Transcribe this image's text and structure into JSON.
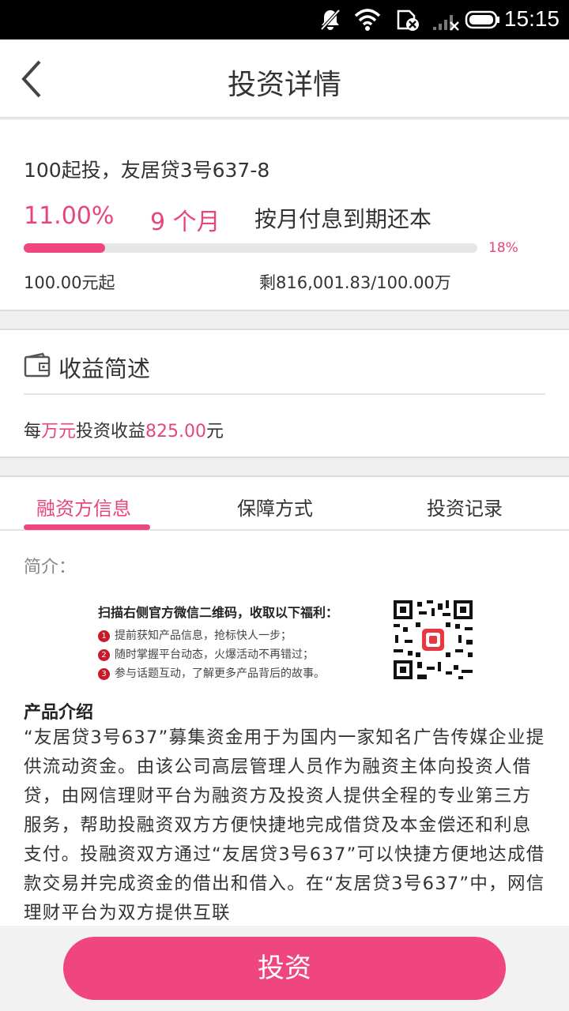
{
  "status_bar": {
    "time": "15:15",
    "icons": [
      "notifications-muted-icon",
      "wifi-icon",
      "sim-disabled-icon",
      "signal-icon",
      "battery-icon"
    ]
  },
  "nav": {
    "title": "投资详情",
    "back_icon": "chevron-left-icon"
  },
  "summary": {
    "name": "100起投，友居贷3号637-8",
    "rate": "11.00%",
    "term": "9 个月",
    "repayment": "按月付息到期还本",
    "progress_fraction": 0.18,
    "progress_label": "18%",
    "min_invest": "100.00元起",
    "remaining": "剩816,001.83/100.00万"
  },
  "earnings": {
    "heading": "收益简述",
    "icon": "wallet-icon",
    "prefix": "每",
    "unit_highlight": "万元",
    "middle": "投资收益",
    "amount": "825.00",
    "suffix": "元"
  },
  "tabs": [
    {
      "label": "融资方信息",
      "active": true
    },
    {
      "label": "保障方式",
      "active": false
    },
    {
      "label": "投资记录",
      "active": false
    }
  ],
  "detail": {
    "intro_label": "简介：",
    "promo": {
      "heading": "扫描右侧官方微信二维码，收取以下福利：",
      "items": [
        {
          "num": "1",
          "text": "提前获知产品信息，抢标快人一步；"
        },
        {
          "num": "2",
          "text": "随时掌握平台动态，火爆活动不再错过；"
        },
        {
          "num": "3",
          "text": "参与话题互动，了解更多产品背后的故事。"
        }
      ],
      "qr_icon": "qr-code-icon"
    },
    "product_title": "产品介绍",
    "product_body": "“友居贷3号637”募集资金用于为国内一家知名广告传媒企业提供流动资金。由该公司高层管理人员作为融资主体向投资人借贷，由网信理财平台为融资方及投资人提供全程的专业第三方服务，帮助投融资双方方便快捷地完成借贷及本金偿还和利息支付。投融资双方通过“友居贷3号637”可以快捷方便地达成借款交易并完成资金的借出和借入。在“友居贷3号637”中，网信理财平台为双方提供互联"
  },
  "invest_button": "投资",
  "colors": {
    "accent": "#f0467f",
    "accent_text": "#e8457b"
  }
}
